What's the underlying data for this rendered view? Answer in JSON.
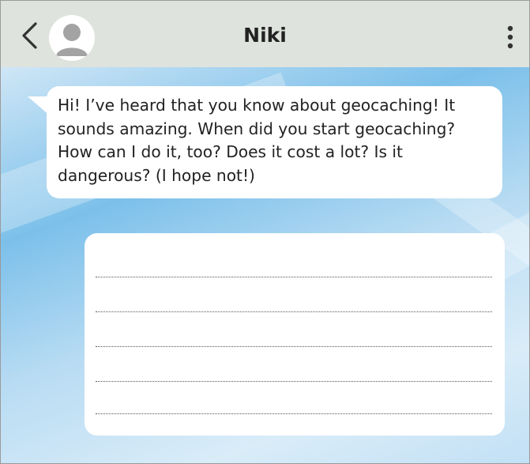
{
  "header": {
    "contact_name": "Niki",
    "back_icon": "chevron-left-icon",
    "avatar_icon": "user-avatar-icon",
    "menu_icon": "more-vertical-icon"
  },
  "conversation": {
    "incoming_message": "Hi! I’ve heard that you know about geocaching! It sounds amazing. When did you start geocaching? How can I do it, too? Does it cost a lot? Is it dangerous? (I hope not!)",
    "reply_lines_count": 5
  },
  "colors": {
    "header_bg": "#dfe3de",
    "chat_bg": "#7cc0ea",
    "bubble_bg": "#ffffff"
  }
}
